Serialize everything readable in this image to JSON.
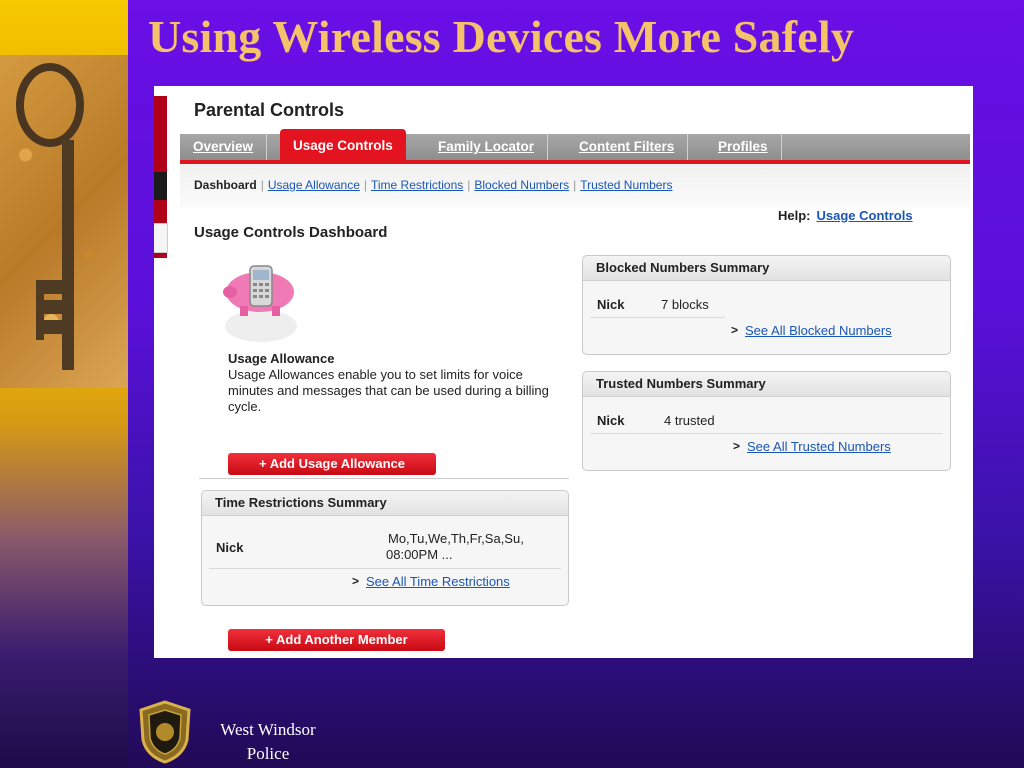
{
  "slide": {
    "title": "Using Wireless Devices More Safely",
    "footer_line1": "West Windsor",
    "footer_line2": "Police",
    "colors": {
      "title": "#f3c26a",
      "background": "#5a10d8",
      "accent_band": "#f4c200"
    }
  },
  "app": {
    "title": "Parental Controls",
    "tabs": [
      {
        "label": "Overview",
        "active": false
      },
      {
        "label": "Usage Controls",
        "active": true
      },
      {
        "label": "Family Locator",
        "active": false
      },
      {
        "label": "Content Filters",
        "active": false
      },
      {
        "label": "Profiles",
        "active": false
      }
    ],
    "subnav": {
      "current": "Dashboard",
      "links": [
        "Usage Allowance",
        "Time Restrictions",
        "Blocked Numbers",
        "Trusted Numbers"
      ]
    },
    "help": {
      "label": "Help:",
      "link": "Usage Controls"
    },
    "dashboard_title": "Usage Controls Dashboard",
    "usage_allowance": {
      "title": "Usage Allowance",
      "description": "Usage Allowances enable you to set limits for voice minutes and messages that can be used during a billing cycle.",
      "add_button": "+ Add Usage Allowance"
    },
    "time_restrictions": {
      "header": "Time Restrictions Summary",
      "name": "Nick",
      "schedule_line1": "Mo,Tu,We,Th,Fr,Sa,Su,",
      "schedule_line2": "08:00PM ...",
      "see_all": "See All Time Restrictions"
    },
    "add_member_button": "+ Add Another Member",
    "blocked": {
      "header": "Blocked Numbers Summary",
      "name": "Nick",
      "value": "7 blocks",
      "see_all": "See All Blocked Numbers"
    },
    "trusted": {
      "header": "Trusted Numbers Summary",
      "name": "Nick",
      "value": "4 trusted",
      "see_all": "See All Trusted Numbers"
    },
    "colors": {
      "tab_active": "#e3141f",
      "link": "#1a56b7",
      "button": "#e3141f"
    }
  }
}
